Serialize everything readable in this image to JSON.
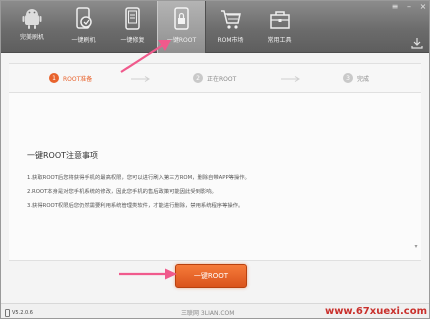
{
  "header": {
    "logo_text": "完美刷机",
    "nav": [
      {
        "label": "一键刷机",
        "icon": "phone-brush-icon"
      },
      {
        "label": "一键修复",
        "icon": "phone-repair-icon"
      },
      {
        "label": "一键ROOT",
        "icon": "lock-icon",
        "active": true
      },
      {
        "label": "ROM市场",
        "icon": "cart-icon"
      },
      {
        "label": "常用工具",
        "icon": "toolbox-icon"
      }
    ],
    "window_buttons": {
      "menu": "≡",
      "minimize": "–",
      "close": "×"
    }
  },
  "steps": [
    {
      "num": "1",
      "label": "ROOT准备"
    },
    {
      "num": "2",
      "label": "正在ROOT"
    },
    {
      "num": "3",
      "label": "完成"
    }
  ],
  "notice": {
    "title": "一键ROOT注意事项",
    "lines": [
      "1.获取ROOT后您将获得手机的最高权限，您可以进行刷入第三方ROM，删除自带APP等操作。",
      "2.ROOT本身是对您手机系统的修改，因此您手机的售后政策可能因此受到影响。",
      "3.获得ROOT权限后您仍然需要利用系统管理类软件，才能进行删除，禁用系统程序等操作。"
    ]
  },
  "root_button": "一键ROOT",
  "footer": {
    "version": "V5.2.0.6",
    "brand": "三联网 3LIAN.COM",
    "watermark": "www.67xuexi.com"
  },
  "colors": {
    "accent": "#e8632d",
    "annotation": "#f05a8c",
    "header": "#6c6c6c"
  }
}
